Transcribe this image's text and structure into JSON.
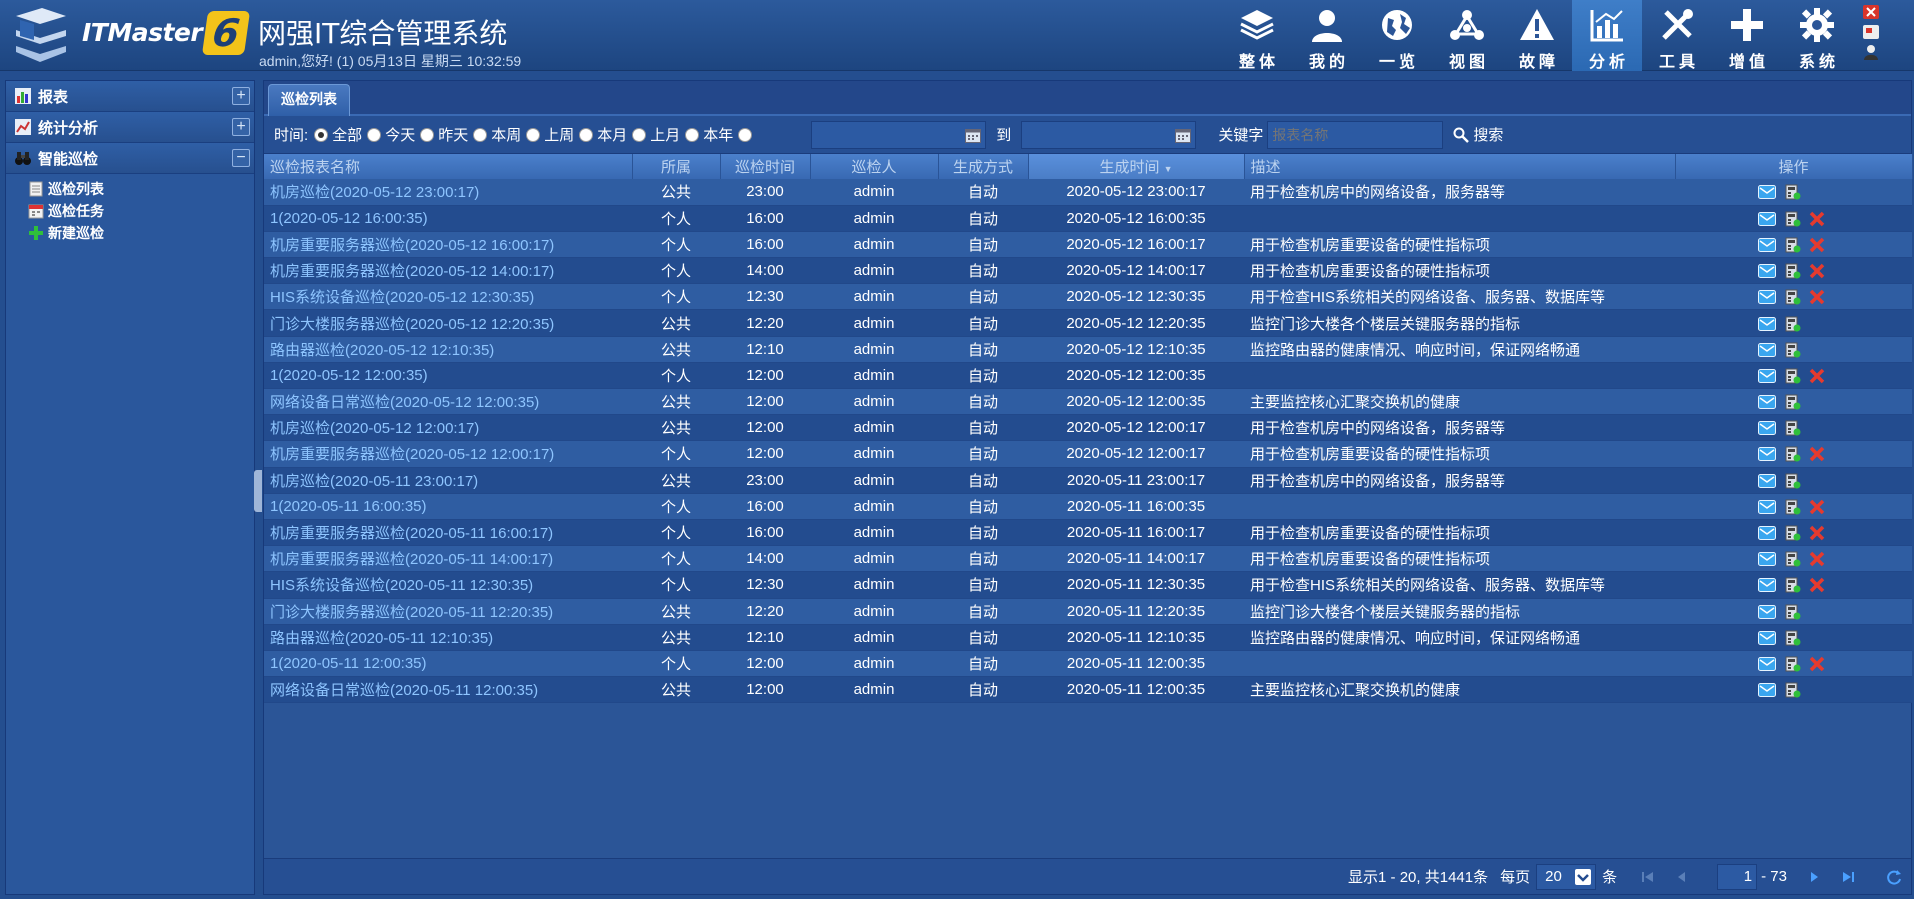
{
  "header": {
    "logo_text": "ITMaster",
    "logo_version": "6",
    "title": "网强IT综合管理系统",
    "greeting": "admin,您好! (1) 05月13日 星期三 10:32:59",
    "nav": [
      {
        "label": "整体",
        "icon": "layers-icon"
      },
      {
        "label": "我的",
        "icon": "user-icon"
      },
      {
        "label": "一览",
        "icon": "globe-icon"
      },
      {
        "label": "视图",
        "icon": "topology-icon"
      },
      {
        "label": "故障",
        "icon": "warning-icon"
      },
      {
        "label": "分析",
        "icon": "bar-chart-icon"
      },
      {
        "label": "工具",
        "icon": "tools-icon"
      },
      {
        "label": "增值",
        "icon": "plus-icon"
      },
      {
        "label": "系统",
        "icon": "gear-icon"
      }
    ],
    "active_nav": "分析"
  },
  "sidebar": {
    "sections": [
      {
        "label": "报表",
        "toggle": "+"
      },
      {
        "label": "统计分析",
        "toggle": "+"
      },
      {
        "label": "智能巡检",
        "toggle": "−"
      }
    ],
    "items": [
      {
        "label": "巡检列表"
      },
      {
        "label": "巡检任务"
      },
      {
        "label": "新建巡检"
      }
    ]
  },
  "tab": {
    "label": "巡检列表"
  },
  "filter": {
    "time_label": "时间:",
    "options": [
      "全部",
      "今天",
      "昨天",
      "本周",
      "上周",
      "本月",
      "上月",
      "本年"
    ],
    "selected": "全部",
    "to_label": "到",
    "keyword_label": "关键字",
    "keyword_placeholder": "报表名称",
    "search_label": "搜索"
  },
  "table": {
    "columns": [
      "巡检报表名称",
      "所属",
      "巡检时间",
      "巡检人",
      "生成方式",
      "生成时间",
      "描述",
      "操作"
    ],
    "rows": [
      {
        "name": "机房巡检(2020-05-12 23:00:17)",
        "owner": "公共",
        "time": "23:00",
        "user": "admin",
        "mode": "自动",
        "created": "2020-05-12 23:00:17",
        "desc": "用于检查机房中的网络设备，服务器等",
        "deletable": false
      },
      {
        "name": "1(2020-05-12 16:00:35)",
        "owner": "个人",
        "time": "16:00",
        "user": "admin",
        "mode": "自动",
        "created": "2020-05-12 16:00:35",
        "desc": "",
        "deletable": true
      },
      {
        "name": "机房重要服务器巡检(2020-05-12 16:00:17)",
        "owner": "个人",
        "time": "16:00",
        "user": "admin",
        "mode": "自动",
        "created": "2020-05-12 16:00:17",
        "desc": "用于检查机房重要设备的硬性指标项",
        "deletable": true
      },
      {
        "name": "机房重要服务器巡检(2020-05-12 14:00:17)",
        "owner": "个人",
        "time": "14:00",
        "user": "admin",
        "mode": "自动",
        "created": "2020-05-12 14:00:17",
        "desc": "用于检查机房重要设备的硬性指标项",
        "deletable": true
      },
      {
        "name": "HIS系统设备巡检(2020-05-12 12:30:35)",
        "owner": "个人",
        "time": "12:30",
        "user": "admin",
        "mode": "自动",
        "created": "2020-05-12 12:30:35",
        "desc": "用于检查HIS系统相关的网络设备、服务器、数据库等",
        "deletable": true
      },
      {
        "name": "门诊大楼服务器巡检(2020-05-12 12:20:35)",
        "owner": "公共",
        "time": "12:20",
        "user": "admin",
        "mode": "自动",
        "created": "2020-05-12 12:20:35",
        "desc": "监控门诊大楼各个楼层关键服务器的指标",
        "deletable": false
      },
      {
        "name": "路由器巡检(2020-05-12 12:10:35)",
        "owner": "公共",
        "time": "12:10",
        "user": "admin",
        "mode": "自动",
        "created": "2020-05-12 12:10:35",
        "desc": "监控路由器的健康情况、响应时间，保证网络畅通",
        "deletable": false
      },
      {
        "name": "1(2020-05-12 12:00:35)",
        "owner": "个人",
        "time": "12:00",
        "user": "admin",
        "mode": "自动",
        "created": "2020-05-12 12:00:35",
        "desc": "",
        "deletable": true
      },
      {
        "name": "网络设备日常巡检(2020-05-12 12:00:35)",
        "owner": "公共",
        "time": "12:00",
        "user": "admin",
        "mode": "自动",
        "created": "2020-05-12 12:00:35",
        "desc": "主要监控核心汇聚交换机的健康",
        "deletable": false
      },
      {
        "name": "机房巡检(2020-05-12 12:00:17)",
        "owner": "公共",
        "time": "12:00",
        "user": "admin",
        "mode": "自动",
        "created": "2020-05-12 12:00:17",
        "desc": "用于检查机房中的网络设备，服务器等",
        "deletable": false
      },
      {
        "name": "机房重要服务器巡检(2020-05-12 12:00:17)",
        "owner": "个人",
        "time": "12:00",
        "user": "admin",
        "mode": "自动",
        "created": "2020-05-12 12:00:17",
        "desc": "用于检查机房重要设备的硬性指标项",
        "deletable": true
      },
      {
        "name": "机房巡检(2020-05-11 23:00:17)",
        "owner": "公共",
        "time": "23:00",
        "user": "admin",
        "mode": "自动",
        "created": "2020-05-11 23:00:17",
        "desc": "用于检查机房中的网络设备，服务器等",
        "deletable": false
      },
      {
        "name": "1(2020-05-11 16:00:35)",
        "owner": "个人",
        "time": "16:00",
        "user": "admin",
        "mode": "自动",
        "created": "2020-05-11 16:00:35",
        "desc": "",
        "deletable": true
      },
      {
        "name": "机房重要服务器巡检(2020-05-11 16:00:17)",
        "owner": "个人",
        "time": "16:00",
        "user": "admin",
        "mode": "自动",
        "created": "2020-05-11 16:00:17",
        "desc": "用于检查机房重要设备的硬性指标项",
        "deletable": true
      },
      {
        "name": "机房重要服务器巡检(2020-05-11 14:00:17)",
        "owner": "个人",
        "time": "14:00",
        "user": "admin",
        "mode": "自动",
        "created": "2020-05-11 14:00:17",
        "desc": "用于检查机房重要设备的硬性指标项",
        "deletable": true
      },
      {
        "name": "HIS系统设备巡检(2020-05-11 12:30:35)",
        "owner": "个人",
        "time": "12:30",
        "user": "admin",
        "mode": "自动",
        "created": "2020-05-11 12:30:35",
        "desc": "用于检查HIS系统相关的网络设备、服务器、数据库等",
        "deletable": true
      },
      {
        "name": "门诊大楼服务器巡检(2020-05-11 12:20:35)",
        "owner": "公共",
        "time": "12:20",
        "user": "admin",
        "mode": "自动",
        "created": "2020-05-11 12:20:35",
        "desc": "监控门诊大楼各个楼层关键服务器的指标",
        "deletable": false
      },
      {
        "name": "路由器巡检(2020-05-11 12:10:35)",
        "owner": "公共",
        "time": "12:10",
        "user": "admin",
        "mode": "自动",
        "created": "2020-05-11 12:10:35",
        "desc": "监控路由器的健康情况、响应时间，保证网络畅通",
        "deletable": false
      },
      {
        "name": "1(2020-05-11 12:00:35)",
        "owner": "个人",
        "time": "12:00",
        "user": "admin",
        "mode": "自动",
        "created": "2020-05-11 12:00:35",
        "desc": "",
        "deletable": true
      },
      {
        "name": "网络设备日常巡检(2020-05-11 12:00:35)",
        "owner": "公共",
        "time": "12:00",
        "user": "admin",
        "mode": "自动",
        "created": "2020-05-11 12:00:35",
        "desc": "主要监控核心汇聚交换机的健康",
        "deletable": false
      }
    ]
  },
  "footer": {
    "summary": "显示1 - 20, 共1441条",
    "per_page_label": "每页",
    "per_page_value": "20",
    "per_page_unit": "条",
    "current_page": "1",
    "total_pages": "- 73"
  },
  "colors": {
    "background": "#244e8f",
    "link": "#8ec5ff",
    "delete": "#e63a2e",
    "accent": "#f3c31a"
  }
}
